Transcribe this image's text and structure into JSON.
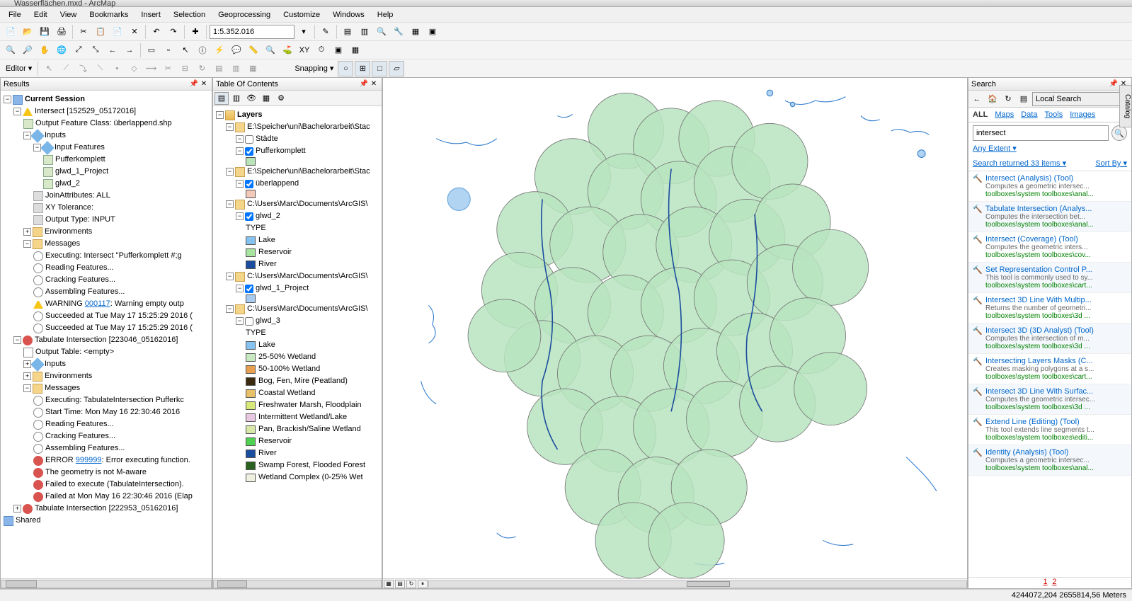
{
  "window": {
    "title": "Wasserflächen.mxd - ArcMap"
  },
  "menu": [
    "File",
    "Edit",
    "View",
    "Bookmarks",
    "Insert",
    "Selection",
    "Geoprocessing",
    "Customize",
    "Windows",
    "Help"
  ],
  "toolbar": {
    "scale": "1:5.352.016"
  },
  "editor_label": "Editor",
  "snapping_label": "Snapping",
  "panels": {
    "results": {
      "title": "Results"
    },
    "toc": {
      "title": "Table Of Contents"
    },
    "search": {
      "title": "Search"
    }
  },
  "results_tree": {
    "root": "Current Session",
    "items": [
      "Intersect [152529_05172016]",
      "Output Feature Class: überlappend.shp",
      "Inputs",
      "Input Features",
      "Pufferkomplett",
      "glwd_1_Project",
      "glwd_2",
      "JoinAttributes: ALL",
      "XY Tolerance:",
      "Output Type: INPUT",
      "Environments",
      "Messages",
      "Executing: Intersect \"Pufferkomplett #;g",
      "Reading Features...",
      "Cracking Features...",
      "Assembling Features...",
      "WARNING 000117: Warning empty outp",
      "Succeeded at Tue May 17 15:25:29 2016 (",
      "Succeeded at Tue May 17 15:25:29 2016 (",
      "Tabulate Intersection [223046_05162016]",
      "Output Table: <empty>",
      "Inputs",
      "Environments",
      "Messages",
      "Executing: TabulateIntersection Pufferkc",
      "Start Time: Mon May 16 22:30:46 2016",
      "Reading Features...",
      "Cracking Features...",
      "Assembling Features...",
      "ERROR 999999: Error executing function.",
      "The geometry is not M-aware",
      "Failed to execute (TabulateIntersection).",
      "Failed at Mon May 16 22:30:46 2016 (Elap",
      "Tabulate Intersection [222953_05162016]",
      "Shared"
    ],
    "warn_code": "000117",
    "err_code": "999999"
  },
  "toc": {
    "root": "Layers",
    "groups": [
      {
        "src": "E:\\Speicher\\uni\\Bachelorarbeit\\Stac",
        "layers": [
          {
            "name": "Städte",
            "checked": false
          },
          {
            "name": "Pufferkomplett",
            "checked": true,
            "swatch": "#b8e4b8"
          }
        ]
      },
      {
        "src": "E:\\Speicher\\uni\\Bachelorarbeit\\Stac",
        "layers": [
          {
            "name": "überlappend",
            "checked": true,
            "swatch": "#f2c9b8"
          }
        ]
      },
      {
        "src": "C:\\Users\\Marc\\Documents\\ArcGIS\\",
        "layers": [
          {
            "name": "glwd_2",
            "checked": true,
            "typeLabel": "TYPE",
            "classes": [
              {
                "label": "Lake",
                "color": "#85c2f0"
              },
              {
                "label": "Reservoir",
                "color": "#a8e4a0"
              },
              {
                "label": "River",
                "color": "#1a4d9e"
              }
            ]
          }
        ]
      },
      {
        "src": "C:\\Users\\Marc\\Documents\\ArcGIS\\",
        "layers": [
          {
            "name": "glwd_1_Project",
            "checked": true,
            "swatch": "#a8ccf0"
          }
        ]
      },
      {
        "src": "C:\\Users\\Marc\\Documents\\ArcGIS\\",
        "layers": [
          {
            "name": "glwd_3",
            "checked": false,
            "typeLabel": "TYPE",
            "classes": [
              {
                "label": "Lake",
                "color": "#85c2f0"
              },
              {
                "label": "25-50% Wetland",
                "color": "#c8e8c0"
              },
              {
                "label": "50-100% Wetland",
                "color": "#e8a050"
              },
              {
                "label": "Bog, Fen, Mire (Peatland)",
                "color": "#3a2a10"
              },
              {
                "label": "Coastal Wetland",
                "color": "#e8c068"
              },
              {
                "label": "Freshwater Marsh, Floodplain",
                "color": "#d8e878"
              },
              {
                "label": "Intermittent Wetland/Lake",
                "color": "#e8c8e0"
              },
              {
                "label": "Pan, Brackish/Saline Wetland",
                "color": "#d8e8a8"
              },
              {
                "label": "Reservoir",
                "color": "#50d050"
              },
              {
                "label": "River",
                "color": "#1a4d9e"
              },
              {
                "label": "Swamp Forest, Flooded Forest",
                "color": "#2a6020"
              },
              {
                "label": "Wetland Complex (0-25% Wet",
                "color": "#f0f0e0"
              }
            ]
          }
        ]
      }
    ]
  },
  "search": {
    "scope": "Local Search",
    "filters": [
      "ALL",
      "Maps",
      "Data",
      "Tools",
      "Images"
    ],
    "active_filter": "ALL",
    "query": "intersect",
    "extent": "Any Extent",
    "count_label": "Search returned 33 items",
    "sort_label": "Sort By",
    "results": [
      {
        "title": "Intersect",
        "cat": "(Analysis)",
        "type": "(Tool)",
        "desc": "Computes a geometric intersec...",
        "path": "toolboxes\\system toolboxes\\anal..."
      },
      {
        "title": "Tabulate Intersection",
        "cat": "(Analys...",
        "type": "",
        "desc": "Computes the intersection bet...",
        "path": "toolboxes\\system toolboxes\\anal..."
      },
      {
        "title": "Intersect",
        "cat": "(Coverage)",
        "type": "(Tool)",
        "desc": "Computes the geometric inters...",
        "path": "toolboxes\\system toolboxes\\cov..."
      },
      {
        "title": "Set Representation Control P...",
        "cat": "",
        "type": "",
        "desc": "This tool is commonly used to sy...",
        "path": "toolboxes\\system toolboxes\\cart..."
      },
      {
        "title": "Intersect 3D Line With Multip...",
        "cat": "",
        "type": "",
        "desc": "Returns the number of geometri...",
        "path": "toolboxes\\system toolboxes\\3d ..."
      },
      {
        "title": "Intersect 3D",
        "cat": "(3D Analyst)",
        "type": "(Tool)",
        "desc": "Computes the intersection of m...",
        "path": "toolboxes\\system toolboxes\\3d ..."
      },
      {
        "title": "Intersecting Layers Masks",
        "cat": "(C...",
        "type": "",
        "desc": "Creates masking polygons at a s...",
        "path": "toolboxes\\system toolboxes\\cart..."
      },
      {
        "title": "Intersect 3D Line With Surfac...",
        "cat": "",
        "type": "",
        "desc": "Computes the geometric intersec...",
        "path": "toolboxes\\system toolboxes\\3d ..."
      },
      {
        "title": "Extend Line",
        "cat": "(Editing)",
        "type": "(Tool)",
        "desc": "This tool extends line segments t...",
        "path": "toolboxes\\system toolboxes\\editi..."
      },
      {
        "title": "Identity",
        "cat": "(Analysis)",
        "type": "(Tool)",
        "desc": "Computes a geometric intersec...",
        "path": "toolboxes\\system toolboxes\\anal..."
      }
    ],
    "pages": [
      "1",
      "2"
    ]
  },
  "statusbar": {
    "coords": "4244072,204  2655814,56 Meters"
  },
  "catalog_tab": "Catalog"
}
